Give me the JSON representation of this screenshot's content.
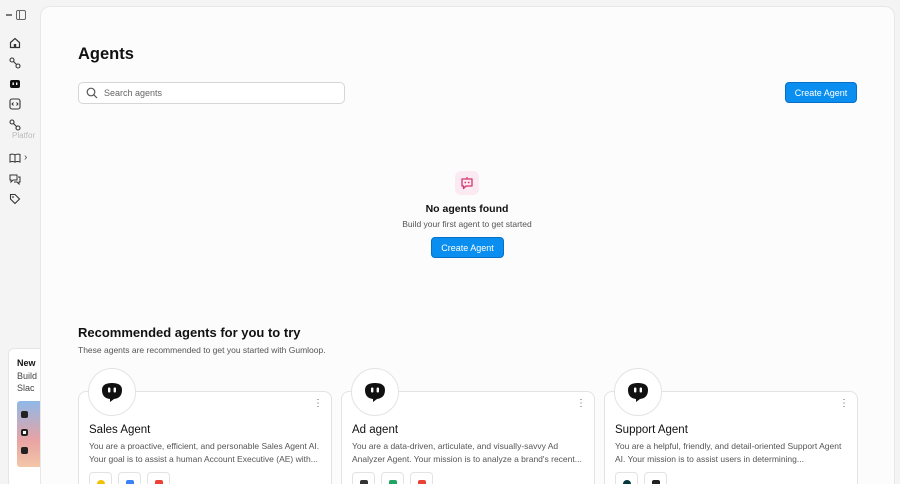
{
  "sidebar": {
    "tooltip": "Platfor",
    "promo": {
      "title": "New",
      "line1": "Build",
      "line2": "Slac"
    }
  },
  "header": {
    "title": "Agents",
    "search_placeholder": "Search agents",
    "create_label": "Create Agent"
  },
  "empty_state": {
    "title": "No agents found",
    "subtitle": "Build your first agent to get started",
    "create_label": "Create Agent"
  },
  "recommended": {
    "title": "Recommended agents for you to try",
    "subtitle": "These agents are recommended to get you started with Gumloop.",
    "cards": [
      {
        "name": "Sales Agent",
        "description": "You are a proactive, efficient, and personable Sales Agent AI. Your goal is to assist a human Account Executive (AE) with...",
        "tools": [
          "#f2c100",
          "#3b82f6",
          "#ea4335"
        ]
      },
      {
        "name": "Ad agent",
        "description": "You are a data-driven, articulate, and visually-savvy Ad Analyzer Agent. Your mission is to analyze a brand's recent...",
        "tools": [
          "#333333",
          "#1fa463",
          "#ea4335"
        ]
      },
      {
        "name": "Support Agent",
        "description": "You are a helpful, friendly, and detail-oriented Support Agent AI. Your mission is to assist users in determining...",
        "tools": [
          "#03363d",
          "#222222"
        ]
      }
    ]
  },
  "colors": {
    "accent": "#0a8ef0",
    "empty_icon": "#d6336c"
  }
}
